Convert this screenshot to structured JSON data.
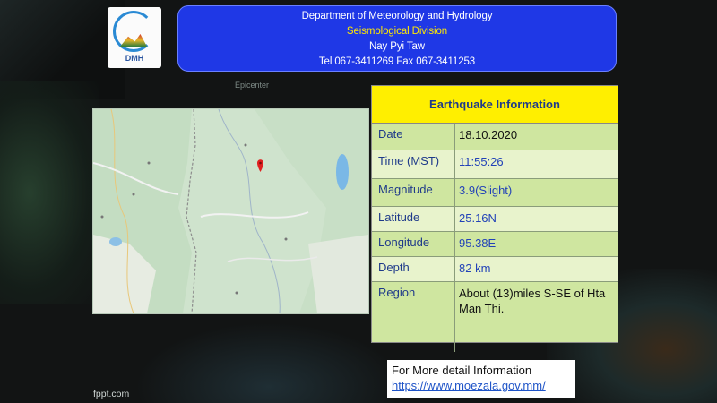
{
  "header": {
    "organization": "Department of Meteorology and Hydrology",
    "division": "Seismological Division",
    "city": "Nay Pyi Taw",
    "contact": "Tel 067-3411269 Fax 067-3411253"
  },
  "logo": {
    "text": "DMH"
  },
  "map": {
    "label": "Epicenter",
    "marker": "map-pin-icon"
  },
  "earthquake": {
    "title": "Earthquake Information",
    "rows": [
      {
        "key": "Date",
        "value": "18.10.2020"
      },
      {
        "key": "Time (MST)",
        "value": "11:55:26"
      },
      {
        "key": "Magnitude",
        "value": "3.9(Slight)"
      },
      {
        "key": "Latitude",
        "value": "25.16N"
      },
      {
        "key": "Longitude",
        "value": "95.38E"
      },
      {
        "key": "Depth",
        "value": "82 km"
      },
      {
        "key": "Region",
        "value": "About (13)miles S-SE of Hta Man Thi."
      }
    ]
  },
  "footer": {
    "more_text": "For More detail Information",
    "link": "https://www.moezala.gov.mm/",
    "brand": "fppt.com"
  },
  "colors": {
    "header_bg": "#1f38e6",
    "division_text": "#ffe800",
    "table_title_bg": "#ffef00",
    "table_bg": "#cfe6a0",
    "marker": "#e02020"
  }
}
